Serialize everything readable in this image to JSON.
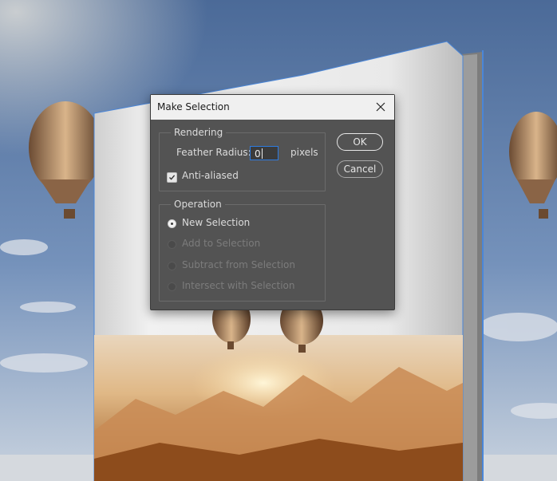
{
  "dialog": {
    "title": "Make Selection",
    "close_icon": "close-icon",
    "rendering": {
      "group_label": "Rendering",
      "feather_label": "Feather Radius:",
      "feather_value": "0",
      "feather_unit": "pixels",
      "anti_aliased_label": "Anti-aliased",
      "anti_aliased_checked": true
    },
    "operation": {
      "group_label": "Operation",
      "options": [
        {
          "label": "New Selection",
          "selected": true,
          "enabled": true
        },
        {
          "label": "Add to Selection",
          "selected": false,
          "enabled": false
        },
        {
          "label": "Subtract from Selection",
          "selected": false,
          "enabled": false
        },
        {
          "label": "Intersect with Selection",
          "selected": false,
          "enabled": false
        }
      ]
    },
    "ok_label": "OK",
    "cancel_label": "Cancel"
  },
  "colors": {
    "dialog_bg": "#535353",
    "titlebar_bg": "#f0f0f0",
    "focus_blue": "#2e7be0"
  }
}
